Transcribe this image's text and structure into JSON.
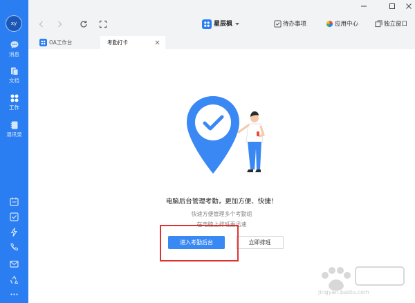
{
  "sidebar": {
    "avatar": "xy",
    "items": [
      {
        "label": "消息",
        "icon": "chat-icon"
      },
      {
        "label": "文档",
        "icon": "document-icon"
      },
      {
        "label": "工作",
        "icon": "apps-icon"
      },
      {
        "label": "通讯录",
        "icon": "contacts-icon"
      }
    ],
    "bottom_icons": [
      "calendar-icon",
      "task-check-icon",
      "lightning-icon",
      "phone-icon",
      "mail-icon",
      "recycle-icon",
      "more-icon"
    ]
  },
  "topbar": {
    "title": "星辰枫",
    "todo_label": "待办事项",
    "app_center_label": "应用中心",
    "standalone_label": "独立窗口"
  },
  "tabs": [
    {
      "label": "OA工作台"
    },
    {
      "label": "考勤打卡"
    }
  ],
  "main": {
    "headline": "电脑后台管理考勤，更加方便、快捷！",
    "sub1": "快速方便管理多个考勤组",
    "sub2": "在电脑上排班更迅速",
    "primary_button": "进入考勤后台",
    "secondary_button": "立即排班"
  },
  "watermark": {
    "text": "jingyan.baidu.com"
  },
  "colors": {
    "accent": "#2a7ef1",
    "button": "#3a88f4",
    "highlight": "#e03131"
  }
}
